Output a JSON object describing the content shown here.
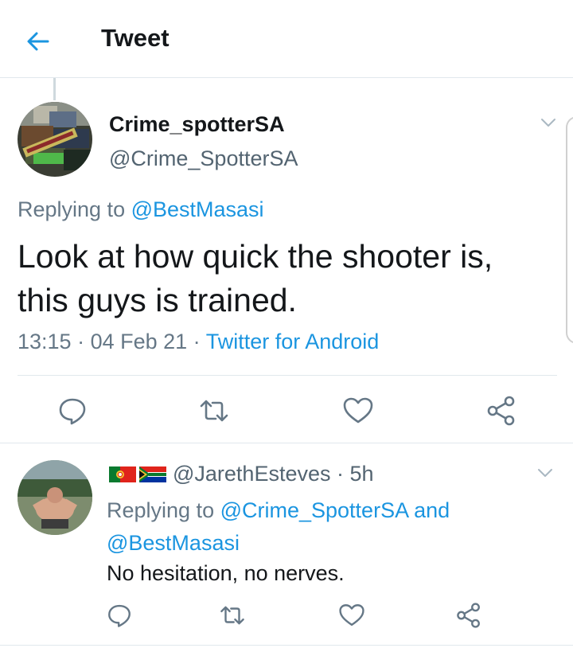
{
  "header": {
    "title": "Tweet",
    "back_icon": "arrow-left-icon"
  },
  "main_tweet": {
    "display_name": "Crime_spotterSA",
    "handle": "@Crime_SpotterSA",
    "replying_prefix": "Replying to ",
    "replying_to": "@BestMasasi",
    "text": "Look at how quick the shooter is, this guys is trained.",
    "time": "13:15",
    "dot": " · ",
    "date": "04 Feb 21",
    "source": "Twitter for Android",
    "actions": [
      "reply-icon",
      "retweet-icon",
      "like-icon",
      "share-icon"
    ]
  },
  "reply": {
    "flags": [
      "portugal-flag-icon",
      "south-africa-flag-icon"
    ],
    "handle": "@JarethEsteves",
    "age": "· 5h",
    "replying_prefix": "Replying to ",
    "replying_to_1": "@Crime_SpotterSA",
    "and": " and ",
    "replying_to_2": "@BestMasasi",
    "text": "No hesitation, no nerves.",
    "actions": [
      "reply-icon",
      "retweet-icon",
      "like-icon",
      "share-icon"
    ]
  },
  "colors": {
    "accent": "#1b95e0",
    "text": "#14171a",
    "muted": "#657786",
    "divider": "#e1e8ed"
  }
}
